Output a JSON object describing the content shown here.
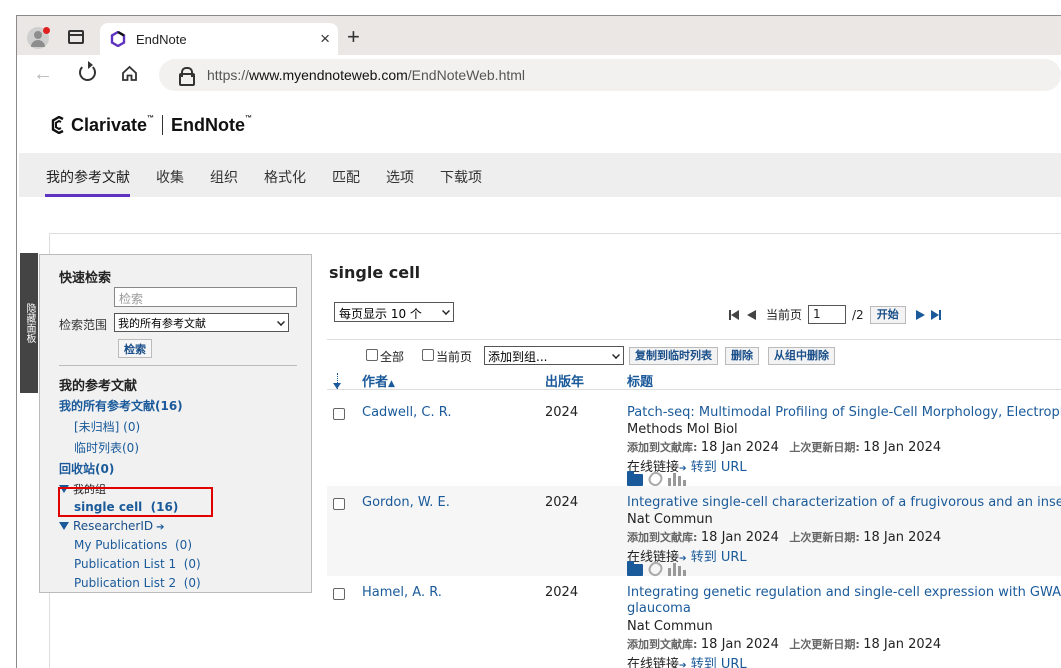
{
  "browser": {
    "tab_title": "EndNote",
    "tab_close": "×",
    "new_tab": "+",
    "url_prefix": "https://",
    "url_domain": "www.myendnoteweb.com",
    "url_path": "/EndNoteWeb.html"
  },
  "brand": {
    "left": "Clarivate",
    "tm": "™",
    "right": "EndNote",
    "tm2": "™"
  },
  "nav": {
    "items": [
      "我的参考文献",
      "收集",
      "组织",
      "格式化",
      "匹配",
      "选项",
      "下载项"
    ]
  },
  "sidebar": {
    "hide_panel": "隐藏面板",
    "quick_search": "快速检索",
    "search_placeholder": "检索",
    "scope_label": "检索范围",
    "scope_value": "我的所有参考文献",
    "search_button": "检索",
    "my_refs": "我的参考文献",
    "all_refs": "我的所有参考文献(16)",
    "unfiled": "[未归档] (0)",
    "quick_list": "临时列表(0)",
    "trash": "回收站(0)",
    "my_groups": "我的组",
    "group_single_cell": "single cell  (16)",
    "researcher_id": "ResearcherID",
    "my_publications": "My Publications  (0)",
    "pub_list_1": "Publication List 1  (0)",
    "pub_list_2": "Publication List 2  (0)"
  },
  "main": {
    "title": "single cell",
    "per_page": "每页显示 10 个",
    "current_page_label": "当前页",
    "current_page": "1",
    "total_pages": "/2",
    "go_button": "开始",
    "select_all": "全部",
    "select_page": "当前页",
    "add_to_group": "添加到组...",
    "copy_to_quick_list": "复制到临时列表",
    "delete": "删除",
    "remove_from_group": "从组中删除",
    "col_author": "作者",
    "col_year": "出版年",
    "col_title": "标题",
    "added_label": "添加到文献库:",
    "updated_label": "上次更新日期:",
    "online_link_label": "在线链接",
    "go_to_url": "转到 URL"
  },
  "records": [
    {
      "author": "Cadwell, C. R.",
      "year": "2024",
      "title": "Patch-seq: Multimodal Profiling of Single-Cell Morphology, Electroph",
      "journal": "Methods Mol Biol",
      "added": "18 Jan 2024",
      "updated": "18 Jan 2024"
    },
    {
      "author": "Gordon, W. E.",
      "year": "2024",
      "title": "Integrative single-cell characterization of a frugivorous and an inse",
      "journal": "Nat Commun",
      "added": "18 Jan 2024",
      "updated": "18 Jan 2024"
    },
    {
      "author": "Hamel, A. R.",
      "year": "2024",
      "title": "Integrating genetic regulation and single-cell expression with GWAS",
      "title2": "glaucoma",
      "journal": "Nat Commun",
      "added": "18 Jan 2024",
      "updated": "18 Jan 2024"
    }
  ]
}
